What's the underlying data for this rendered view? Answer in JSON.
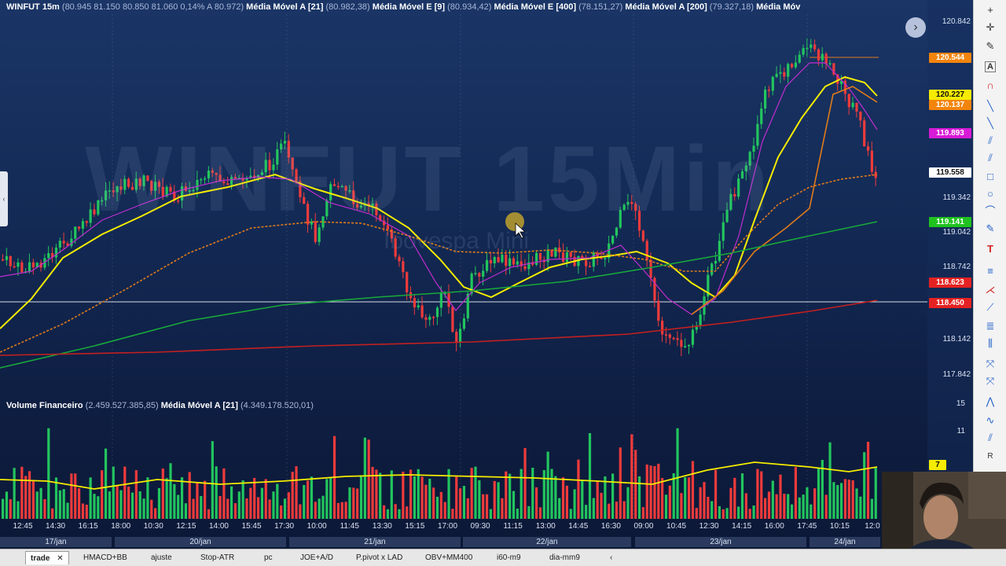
{
  "legend": {
    "symbol": "WINFUT 15m",
    "ohlc": "(80.945  81.150  80.850  81.060  0,14%  A 80.972)",
    "ma1_label": "Média Móvel A [21]",
    "ma1_value": "(80.982,38)",
    "ma2_label": "Média Móvel E [9]",
    "ma2_value": "(80.934,42)",
    "ma3_label": "Média Móvel E [400]",
    "ma3_value": "(78.151,27)",
    "ma4_label": "Média Móvel A [200]",
    "ma4_value": "(79.327,18)",
    "ma5_label": "Média Móv",
    "volume_label": "Volume Financeiro",
    "volume_value": "(2.459.527.385,85)",
    "volume_ma_label": "Média Móvel A [21]",
    "volume_ma_value": "(4.349.178.520,01)"
  },
  "watermark": {
    "main": "WINFUT 15Min",
    "sub": "Ibovespa Mini"
  },
  "price_axis": {
    "ticks": [
      "120.842",
      "119.342",
      "119.042",
      "118.742",
      "118.142",
      "117.842"
    ]
  },
  "price_tags": [
    {
      "value": "120.544",
      "bg": "#f2840c",
      "fg": "#ffffff"
    },
    {
      "value": "120.227",
      "bg": "#f5ec00",
      "fg": "#111111"
    },
    {
      "value": "120.137",
      "bg": "#f2840c",
      "fg": "#ffffff"
    },
    {
      "value": "119.893",
      "bg": "#d81bd6",
      "fg": "#ffffff"
    },
    {
      "value": "119.558",
      "bg": "#ffffff",
      "fg": "#111111"
    },
    {
      "value": "119.141",
      "bg": "#1fc21f",
      "fg": "#ffffff"
    },
    {
      "value": "118.623",
      "bg": "#e52222",
      "fg": "#ffffff"
    },
    {
      "value": "118.450",
      "bg": "#e52222",
      "fg": "#ffffff"
    }
  ],
  "volume_axis": {
    "ticks": [
      "15",
      "11"
    ],
    "current_tag": "7"
  },
  "time_axis": {
    "labels": [
      "12:45",
      "14:30",
      "16:15",
      "18:00",
      "10:30",
      "12:15",
      "14:00",
      "15:45",
      "17:30",
      "10:00",
      "11:45",
      "13:30",
      "15:15",
      "17:00",
      "09:30",
      "11:15",
      "13:00",
      "14:45",
      "16:30",
      "09:00",
      "10:45",
      "12:30",
      "14:15",
      "16:00",
      "17:45",
      "10:15",
      "12:0"
    ],
    "dates": [
      "17/jan",
      "20/jan",
      "21/jan",
      "22/jan",
      "23/jan",
      "24/jan"
    ]
  },
  "tabs": [
    {
      "label": "trade",
      "active": true
    },
    {
      "label": "HMACD+BB"
    },
    {
      "label": "ajuste"
    },
    {
      "label": "Stop-ATR"
    },
    {
      "label": "pc"
    },
    {
      "label": "JOE+A/D"
    },
    {
      "label": "P.pivot x LAD"
    },
    {
      "label": "OBV+MM400"
    },
    {
      "label": "i60-m9"
    },
    {
      "label": "dia-mm9"
    }
  ],
  "tab_close": "✕",
  "tab_scroll": "‹",
  "colors": {
    "up_candle": "#22c55e",
    "down_candle": "#ef3b3b",
    "ma_yellow": "#f5ec00",
    "ma_purple": "#c02ccf",
    "ma_orange": "#e07b1a",
    "ma_green": "#18a83a",
    "ma_red": "#c42020"
  },
  "toolbar_icons": [
    "plus-icon",
    "crosshair-icon",
    "cursor-icon",
    "text-a-icon",
    "magnet-icon",
    "line-icon",
    "ray-icon",
    "parallel-lines-icon",
    "channel-icon",
    "rectangle-icon",
    "ellipse-icon",
    "brush-icon",
    "text-t-icon",
    "fibonacci-icon",
    "fan-icon",
    "pitchfork-icon",
    "retracement-icon",
    "gann-icon",
    "zoom-area-icon",
    "measure-icon",
    "elliott-icon",
    "wave-icon",
    "cycle-icon",
    "ruler-icon"
  ]
}
